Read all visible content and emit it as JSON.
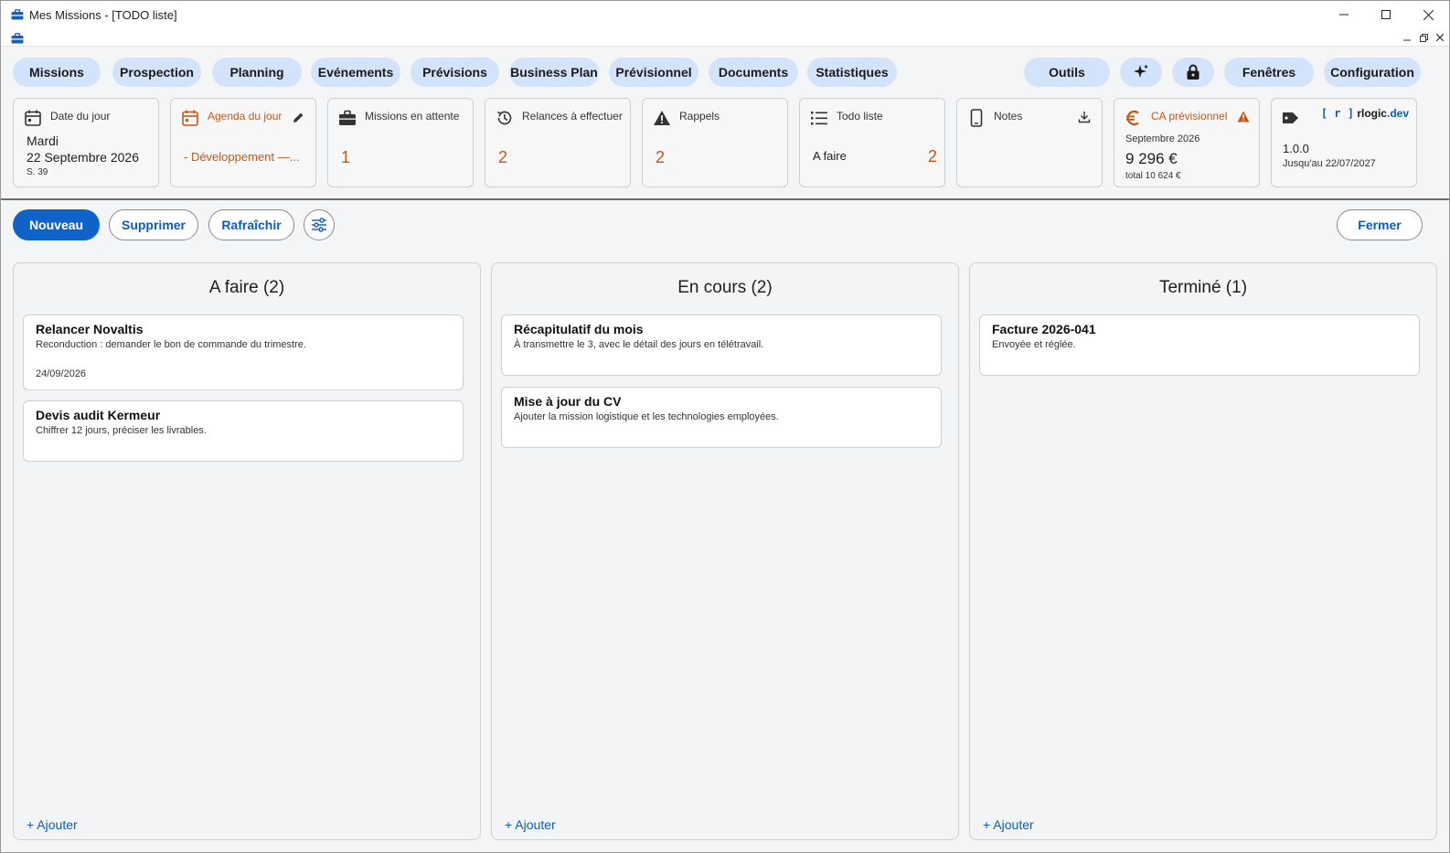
{
  "window": {
    "title": "Mes Missions - [TODO liste]"
  },
  "nav": {
    "missions": "Missions",
    "prospection": "Prospection",
    "planning": "Planning",
    "evenements": "Evénements",
    "previsions": "Prévisions",
    "business_plan": "Business Plan",
    "previsionnel": "Prévisionnel",
    "documents": "Documents",
    "statistiques": "Statistiques",
    "outils": "Outils",
    "fenetres": "Fenêtres",
    "configuration": "Configuration"
  },
  "cards": {
    "date": {
      "title": "Date du jour",
      "day": "Mardi",
      "date": "22 Septembre 2026",
      "week": "S. 39"
    },
    "agenda": {
      "title": "Agenda du jour",
      "entry": "- Développement —..."
    },
    "missions_attente": {
      "title": "Missions en attente",
      "count": "1"
    },
    "relances": {
      "title": "Relances à effectuer",
      "count": "2"
    },
    "rappels": {
      "title": "Rappels",
      "count": "2"
    },
    "todo": {
      "title": "Todo liste",
      "label": "A faire",
      "count": "2"
    },
    "notes": {
      "title": "Notes"
    },
    "ca": {
      "title": "CA prévisionnel",
      "month": "Septembre 2026",
      "amount": "9 296 €",
      "total": "total 10 624 €"
    },
    "version": {
      "brand_bracket": "[ r ]",
      "brand_name": "rlogic",
      "brand_tld": ".dev",
      "version": "1.0.0",
      "until": "Jusqu'au 22/07/2027"
    }
  },
  "toolbar": {
    "nouveau": "Nouveau",
    "supprimer": "Supprimer",
    "rafraichir": "Rafraîchir",
    "fermer": "Fermer"
  },
  "columns": [
    {
      "title": "A faire (2)",
      "add": "+ Ajouter",
      "tasks": [
        {
          "title": "Relancer Novaltis",
          "desc": "Reconduction : demander le bon de commande du trimestre.",
          "date": "24/09/2026"
        },
        {
          "title": "Devis audit Kermeur",
          "desc": "Chiffrer 12 jours, préciser les livrables."
        }
      ]
    },
    {
      "title": "En cours (2)",
      "add": "+ Ajouter",
      "tasks": [
        {
          "title": "Récapitulatif du mois",
          "desc": "À transmettre le 3, avec le détail des jours en télétravail."
        },
        {
          "title": "Mise à jour du CV",
          "desc": "Ajouter la mission logistique et les technologies employées."
        }
      ]
    },
    {
      "title": "Terminé (1)",
      "add": "+ Ajouter",
      "tasks": [
        {
          "title": "Facture 2026-041",
          "desc": "Envoyée et réglée."
        }
      ]
    }
  ],
  "colors": {
    "accent": "#0f63c8",
    "pill": "#d3e3fb",
    "orange": "#c2581b",
    "link": "#0f5bb5"
  },
  "icons": [
    "toolbox-icon",
    "minimize-icon",
    "maximize-icon",
    "close-icon",
    "sparkle-icon",
    "lock-icon",
    "calendar-icon",
    "briefcase-icon",
    "history-icon",
    "warning-icon",
    "list-icon",
    "phone-icon",
    "download-icon",
    "euro-icon",
    "tag-icon",
    "pencil-icon",
    "filter-settings-icon"
  ]
}
